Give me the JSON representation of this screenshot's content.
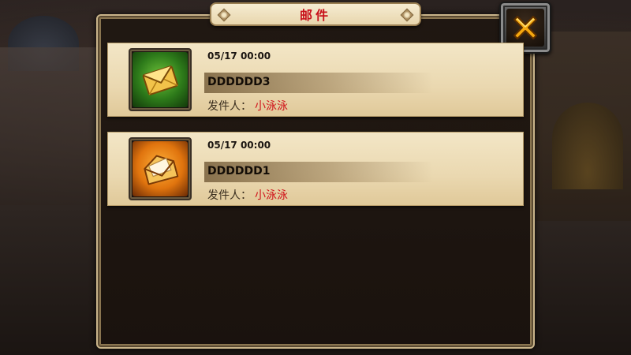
{
  "window": {
    "title": "邮件"
  },
  "colors": {
    "title_text": "#c8101a",
    "sender_name": "#d0121a",
    "panel_parchment": "#ead8b0",
    "frame_border": "#c9b48a",
    "close_x": "#f5a80f"
  },
  "close_button": {
    "icon": "close-x-icon"
  },
  "mails": [
    {
      "date": "05/17  00:00",
      "subject": "DDDDDD3",
      "sender_label": "发件人：",
      "sender_name": "小泳泳",
      "icon": "closed-envelope-icon",
      "status": "unread"
    },
    {
      "date": "05/17  00:00",
      "subject": "DDDDDD1",
      "sender_label": "发件人：",
      "sender_name": "小泳泳",
      "icon": "open-envelope-icon",
      "status": "read"
    }
  ]
}
